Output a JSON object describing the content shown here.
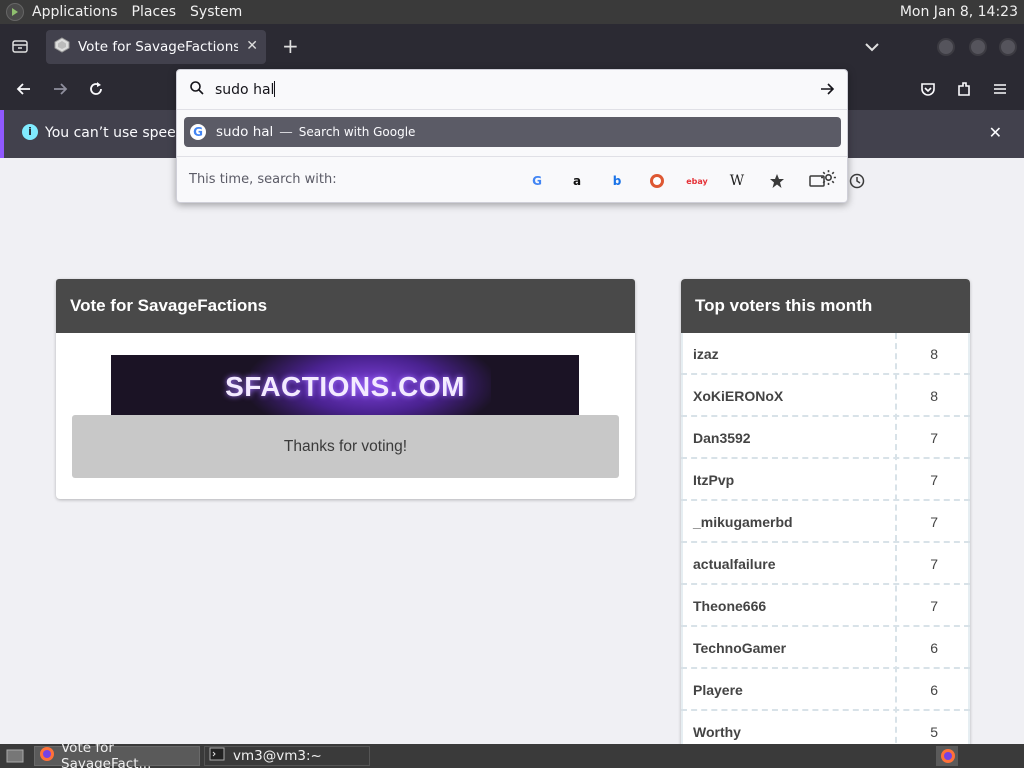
{
  "top_panel": {
    "menus": [
      "Applications",
      "Places",
      "System"
    ],
    "clock": "Mon Jan  8, 14:23"
  },
  "browser": {
    "tab_title": "Vote for SavageFactions | M",
    "notification": "You can’t use speech s",
    "url_query": "sudo hal",
    "suggestion": {
      "term": "sudo hal",
      "separator": "—",
      "action": "Search with Google"
    },
    "engines_label": "This time, search with:"
  },
  "page": {
    "vote_card": {
      "title": "Vote for SavageFactions",
      "banner_text": "SFACTIONS.COM",
      "thanks": "Thanks for voting!"
    },
    "voters_card": {
      "title": "Top voters this month",
      "rows": [
        {
          "name": "izaz",
          "count": "8"
        },
        {
          "name": "XoKiERONoX",
          "count": "8"
        },
        {
          "name": "Dan3592",
          "count": "7"
        },
        {
          "name": "ItzPvp",
          "count": "7"
        },
        {
          "name": "_mikugamerbd",
          "count": "7"
        },
        {
          "name": "actualfailure",
          "count": "7"
        },
        {
          "name": "Theone666",
          "count": "7"
        },
        {
          "name": "TechnoGamer",
          "count": "6"
        },
        {
          "name": "Playere",
          "count": "6"
        },
        {
          "name": "Worthy",
          "count": "5"
        }
      ]
    }
  },
  "taskbar": {
    "tasks": [
      "Vote for SavageFact...",
      "vm3@vm3:~"
    ]
  }
}
